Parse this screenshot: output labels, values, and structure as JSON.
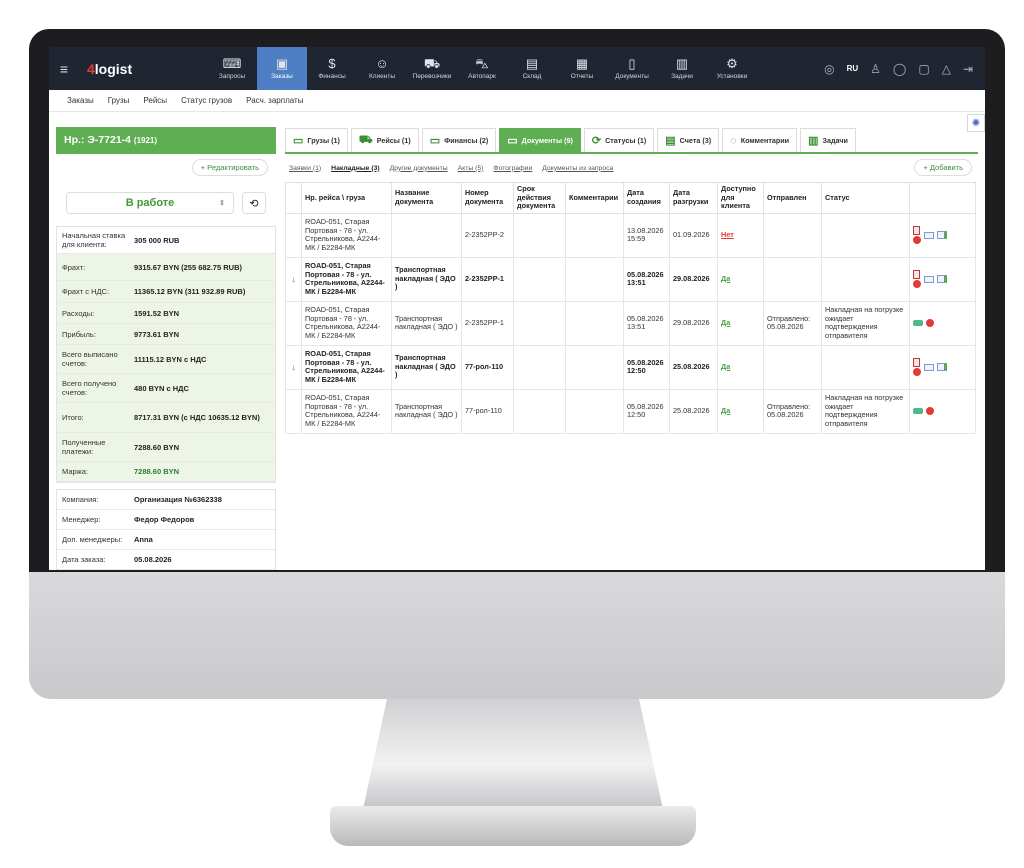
{
  "app": {
    "logo_prefix": "4",
    "logo_text": "logist"
  },
  "nav": [
    {
      "label": "Запросы",
      "icon": "chat-icon",
      "glyph": "⌨"
    },
    {
      "label": "Заказы",
      "icon": "orders-icon",
      "glyph": "▣",
      "active": true
    },
    {
      "label": "Финансы",
      "icon": "money-bag-icon",
      "glyph": "$"
    },
    {
      "label": "Клиенты",
      "icon": "users-icon",
      "glyph": "☺"
    },
    {
      "label": "Перевозчики",
      "icon": "truck-icon",
      "glyph": "⛟"
    },
    {
      "label": "Автопарк",
      "icon": "fleet-icon",
      "glyph": "⛍"
    },
    {
      "label": "Склад",
      "icon": "warehouse-icon",
      "glyph": "▤"
    },
    {
      "label": "Отчеты",
      "icon": "report-icon",
      "glyph": "▦"
    },
    {
      "label": "Документы",
      "icon": "document-icon",
      "glyph": "▯"
    },
    {
      "label": "Задачи",
      "icon": "calendar-icon",
      "glyph": "▥"
    },
    {
      "label": "Установки",
      "icon": "settings-icon",
      "glyph": "⚙"
    }
  ],
  "topright": {
    "lang": "RU"
  },
  "subnav": [
    "Заказы",
    "Грузы",
    "Рейсы",
    "Статус грузов",
    "Расч. зарплаты"
  ],
  "order": {
    "title": "Нр.: Э-7721-4",
    "title_id": "(1921)",
    "edit_label": "+ Редактировать",
    "status": "В работе",
    "rows": [
      {
        "k": "Начальная ставка для клиента:",
        "v": "305 000 RUB",
        "g": false
      },
      {
        "k": "Фрахт:",
        "v": "9315.67 BYN (255 682.75 RUB)",
        "g": true
      },
      {
        "k": "Фрахт с НДС:",
        "v": "11365.12 BYN (311 932.89 RUB)",
        "g": true
      },
      {
        "k": "Расходы:",
        "v": "1591.52 BYN",
        "g": true
      },
      {
        "k": "Прибыль:",
        "v": "9773.61 BYN",
        "g": true
      },
      {
        "k": "Всего выписано счетов:",
        "v": "11115.12 BYN с НДС",
        "g": true
      },
      {
        "k": "Всего получено счетов:",
        "v": "480 BYN с НДС",
        "g": true
      },
      {
        "k": "Итого:",
        "v": "8717.31 BYN (с НДС 10635.12 BYN)",
        "g": true
      },
      {
        "k": "Полученные платежи:",
        "v": "7288.60 BYN",
        "g": true
      },
      {
        "k": "Маржа:",
        "v": "7288.60 BYN",
        "g": true,
        "gv": true
      }
    ],
    "info": [
      {
        "k": "Компания:",
        "v": "Организация №6362338"
      },
      {
        "k": "Менеджер:",
        "v": "Федор Федоров"
      },
      {
        "k": "Доп. менеджеры:",
        "v": "Anna"
      },
      {
        "k": "Дата заказа:",
        "v": "05.08.2026"
      }
    ]
  },
  "tabs": [
    {
      "label": "Грузы (1)",
      "icon": "cargo-icon",
      "glyph": "▭"
    },
    {
      "label": "Рейсы (1)",
      "icon": "bus-icon",
      "glyph": "⛟"
    },
    {
      "label": "Финансы (2)",
      "icon": "finance-icon",
      "glyph": "▭"
    },
    {
      "label": "Документы (9)",
      "icon": "docs-icon",
      "glyph": "▭",
      "active": true
    },
    {
      "label": "Статусы (1)",
      "icon": "refresh-icon",
      "glyph": "⟳"
    },
    {
      "label": "Счета (3)",
      "icon": "invoice-icon",
      "glyph": "▤"
    },
    {
      "label": "Комментарии",
      "icon": "comment-icon",
      "glyph": "◌"
    },
    {
      "label": "Задачи",
      "icon": "task-calendar-icon",
      "glyph": "▥"
    }
  ],
  "doclinks": [
    {
      "label": "Заявки (1)"
    },
    {
      "label": "Накладные (3)",
      "active": true
    },
    {
      "label": "Другие документы"
    },
    {
      "label": "Акты (5)"
    },
    {
      "label": "Фотографии"
    },
    {
      "label": "Документы из запроса"
    }
  ],
  "add_label": "+ Добавить",
  "table": {
    "headers": [
      "Нр. рейса \\ груза",
      "Название документа",
      "Номер документа",
      "Срок действия документа",
      "Комментарии",
      "Дата создания",
      "Дата разгрузки",
      "Доступно для клиента",
      "Отправлен",
      "Статус"
    ],
    "rows": [
      {
        "arrow": "",
        "route": "ROAD-051, Старая Портовая - 78 - ул. Стрельникова, А2244-МК / Б2284-МК",
        "name": "",
        "num": "2-2352PP-2",
        "term": "",
        "comment": "",
        "created": "13.08.2026 15:59",
        "unload": "01.09.2026",
        "avail": "Нет",
        "sent": "",
        "status": "",
        "bold": false,
        "acts": "pdf"
      },
      {
        "arrow": "↓",
        "route": "ROAD-051, Старая Портовая - 78 - ул. Стрельникова, А2244-МК / Б2284-МК",
        "name": "Транспортная накладная ( ЭДО )",
        "num": "2-2352PP-1",
        "term": "",
        "comment": "",
        "created": "05.08.2026 13:51",
        "unload": "29.08.2026",
        "avail": "Да",
        "sent": "",
        "status": "",
        "bold": true,
        "acts": "pdf"
      },
      {
        "arrow": "",
        "route": "ROAD-051, Старая Портовая - 78 - ул. Стрельникова, А2244-МК / Б2284-МК",
        "name": "Транспортная накладная ( ЭДО )",
        "num": "2-2352PP-1",
        "term": "",
        "comment": "",
        "created": "05.08.2026 13:51",
        "unload": "29.08.2026",
        "avail": "Да",
        "sent": "Отправлено: 05.08.2026",
        "status": "Накладная на погрузке ожидает подтверждения отправителя",
        "bold": false,
        "acts": "sent"
      },
      {
        "arrow": "↓",
        "route": "ROAD-051, Старая Портовая - 78 - ул. Стрельникова, А2244-МК / Б2284-МК",
        "name": "Транспортная накладная ( ЭДО )",
        "num": "77-рол-110",
        "term": "",
        "comment": "",
        "created": "05.08.2026 12:50",
        "unload": "25.08.2026",
        "avail": "Да",
        "sent": "",
        "status": "",
        "bold": true,
        "acts": "pdf"
      },
      {
        "arrow": "",
        "route": "ROAD-051, Старая Портовая - 78 - ул. Стрельникова, А2244-МК / Б2284-МК",
        "name": "Транспортная накладная ( ЭДО )",
        "num": "77-рол-110",
        "term": "",
        "comment": "",
        "created": "05.08.2026 12:50",
        "unload": "25.08.2026",
        "avail": "Да",
        "sent": "Отправлено: 05.08.2026",
        "status": "Накладная на погрузке ожидает подтверждения отправителя",
        "bold": false,
        "acts": "sent"
      }
    ]
  }
}
